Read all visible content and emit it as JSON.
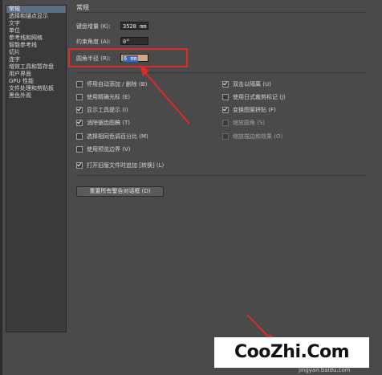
{
  "sidebar": {
    "items": [
      {
        "label": "常规",
        "selected": true
      },
      {
        "label": "选择和锚点显示"
      },
      {
        "label": "文字"
      },
      {
        "label": "单位"
      },
      {
        "label": "参考线和网格"
      },
      {
        "label": "智能参考线"
      },
      {
        "label": "切片"
      },
      {
        "label": "连字"
      },
      {
        "label": "增效工具和暂存盘"
      },
      {
        "label": "用户界面"
      },
      {
        "label": "GPU 性能"
      },
      {
        "label": "文件处理和剪贴板"
      },
      {
        "label": "黑色外观"
      }
    ]
  },
  "panel": {
    "title": "常规"
  },
  "fields": {
    "keyboard_increment": {
      "label": "键盘增量 (K):",
      "value": "3528 mm"
    },
    "constrain_angle": {
      "label": "约束角度 (A):",
      "value": "0°"
    },
    "corner_radius": {
      "label": "圆角半径 (R):",
      "value": "6 mm"
    }
  },
  "options_left": [
    {
      "label": "停用自动添加 / 删除 (B)",
      "checked": false
    },
    {
      "label": "使用精确光标 (E)",
      "checked": false
    },
    {
      "label": "显示工具提示 (I)",
      "checked": true
    },
    {
      "label": "消除锯齿图稿 (T)",
      "checked": true
    },
    {
      "label": "选择相同色调百分比 (M)",
      "checked": false
    },
    {
      "label": "使用预览边界 (V)",
      "checked": false
    }
  ],
  "options_right": [
    {
      "label": "双击以隔离 (U)",
      "checked": true
    },
    {
      "label": "使用日式裁剪标记 (J)",
      "checked": false
    },
    {
      "label": "变换图案拼贴 (F)",
      "checked": true
    },
    {
      "label": "缩放圆角 (S)",
      "checked": false,
      "disabled": true
    },
    {
      "label": "缩放描边和效果 (O)",
      "checked": false,
      "disabled": true
    }
  ],
  "legacy_option": {
    "label": "打开旧版文件时追加 [转换] (L)",
    "checked": true
  },
  "reset_button": {
    "label": "重置所有警告对话框 (D)"
  },
  "watermark": {
    "text": "CooZhi.Com",
    "url": "jingyan.baidu.com"
  },
  "colors": {
    "annotation_red": "#e02828",
    "selection_blue": "#5a6e86"
  }
}
